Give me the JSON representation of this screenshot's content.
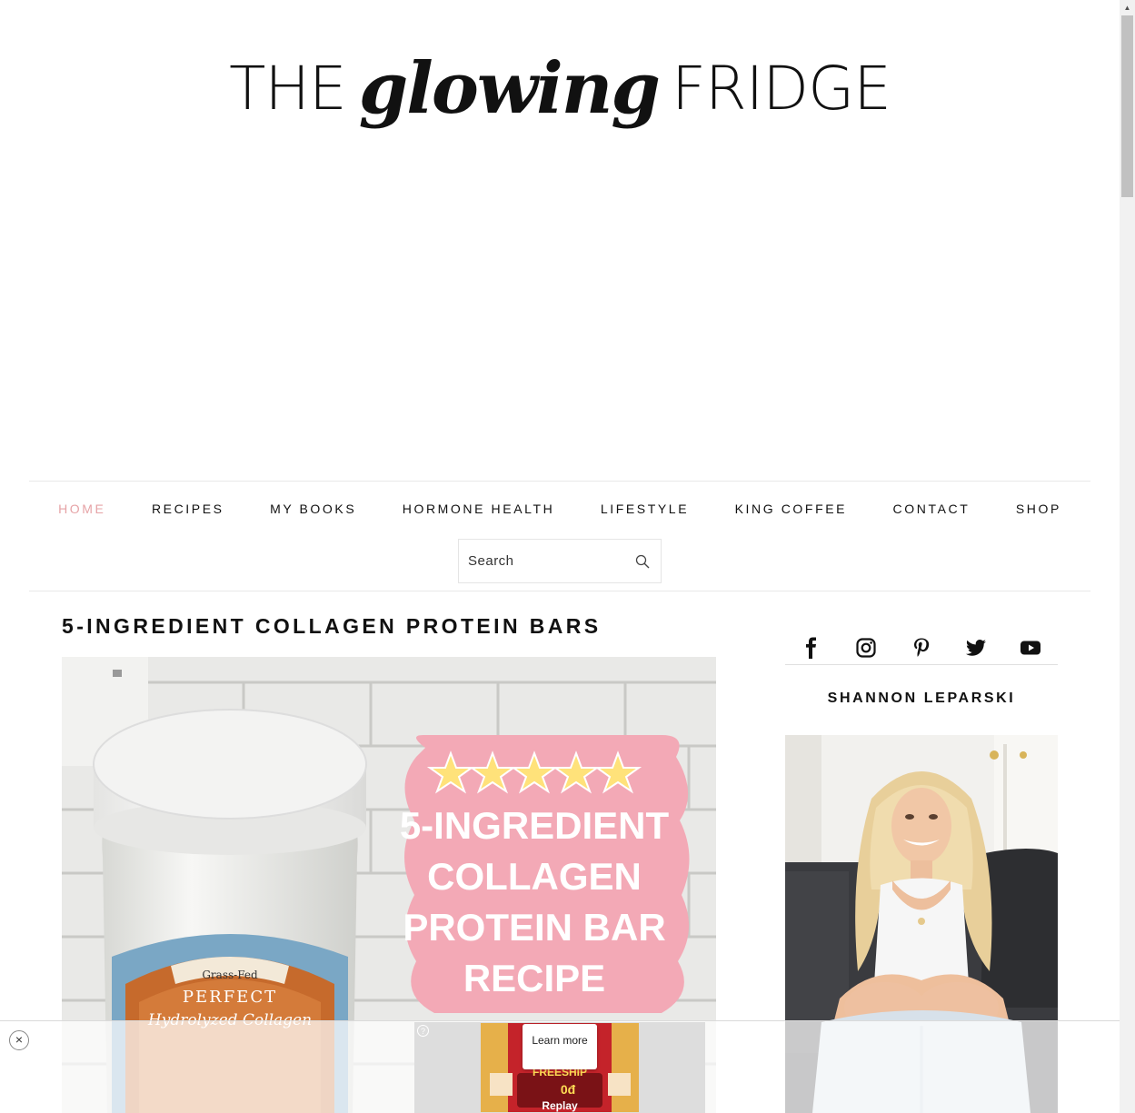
{
  "site": {
    "logo_left": "THE",
    "logo_script": "glowing",
    "logo_right": "FRIDGE"
  },
  "nav": {
    "items": [
      {
        "label": "HOME",
        "active": true
      },
      {
        "label": "RECIPES"
      },
      {
        "label": "MY BOOKS"
      },
      {
        "label": "HORMONE HEALTH"
      },
      {
        "label": "LIFESTYLE"
      },
      {
        "label": "KING COFFEE"
      },
      {
        "label": "CONTACT"
      },
      {
        "label": "SHOP"
      }
    ],
    "active_color": "#e6a3a6"
  },
  "search": {
    "placeholder": "Search"
  },
  "post": {
    "title": "5-INGREDIENT COLLAGEN PROTEIN BARS",
    "image": {
      "badge_lines": [
        "5-INGREDIENT",
        "COLLAGEN",
        "PROTEIN BAR",
        "RECIPE"
      ],
      "jar_label_top": "Grass-Fed",
      "jar_label_brand": "PERFECT",
      "jar_label_product": "Hydrolyzed Collagen",
      "stars": 5,
      "badge_color": "#f3a9b6"
    }
  },
  "sidebar": {
    "social": [
      "facebook-icon",
      "instagram-icon",
      "pinterest-icon",
      "twitter-icon",
      "youtube-icon"
    ],
    "author_name": "SHANNON LEPARSKI"
  },
  "ad": {
    "close_symbol": "×",
    "help_symbol": "?",
    "learn_more": "Learn more",
    "replay": "Replay",
    "creative_text": "FREESHIP",
    "creative_price": "0đ"
  }
}
